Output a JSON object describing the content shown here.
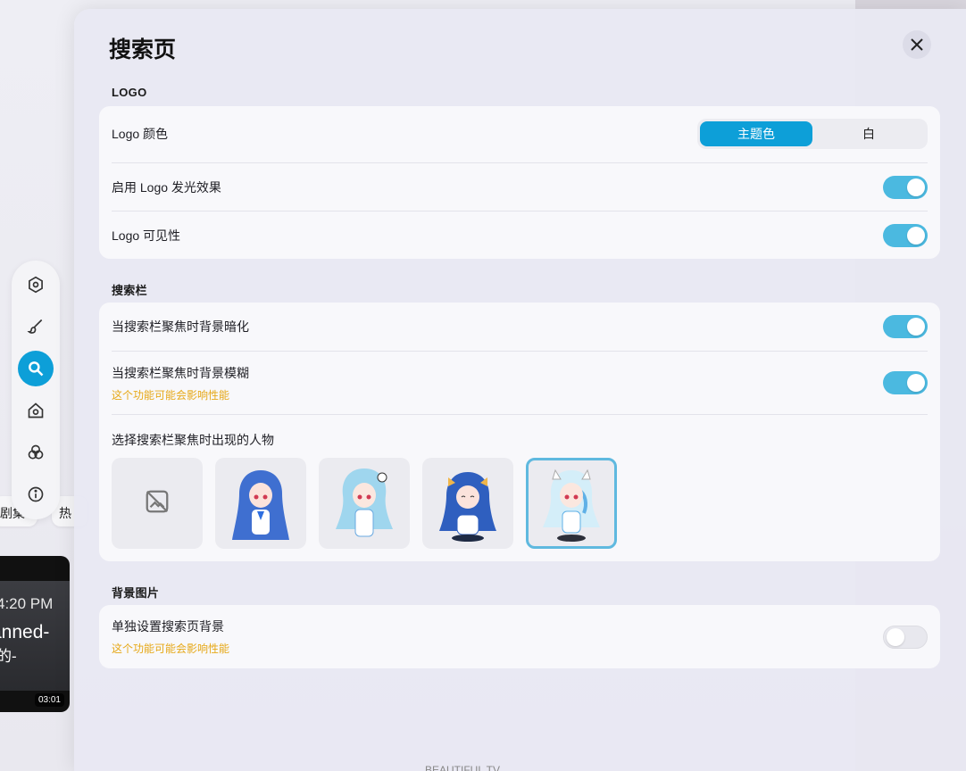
{
  "dialog": {
    "title": "搜索页",
    "close_icon": "close-icon"
  },
  "logo_section": {
    "label": "LOGO",
    "color_row": {
      "label": "Logo 颜色",
      "options": [
        "主题色",
        "白"
      ],
      "selected": "主题色"
    },
    "glow_row": {
      "label": "启用 Logo 发光效果",
      "enabled": true
    },
    "visible_row": {
      "label": "Logo 可见性",
      "enabled": true
    }
  },
  "searchbar_section": {
    "label": "搜索栏",
    "dim_row": {
      "label": "当搜索栏聚焦时背景暗化",
      "enabled": true
    },
    "blur_row": {
      "label": "当搜索栏聚焦时背景模糊",
      "sub": "这个功能可能会影响性能",
      "enabled": true
    },
    "character_row": {
      "label": "选择搜索栏聚焦时出现的人物",
      "options": [
        "none",
        "character-1",
        "character-2",
        "character-3",
        "character-4"
      ],
      "selected": "character-4"
    }
  },
  "background_section": {
    "label": "背景图片",
    "separate_row": {
      "label": "单独设置搜索页背景",
      "sub": "这个功能可能会影响性能",
      "enabled": false
    }
  },
  "side_nav": {
    "items": [
      "settings-icon",
      "brush-icon",
      "search-icon",
      "home-icon",
      "palette-icon",
      "info-icon"
    ],
    "active": "search-icon"
  },
  "background_app": {
    "chip_1": "剧集",
    "chip_2": "热",
    "video": {
      "time": "4:20 PM",
      "line1": "anned-",
      "line2": "的-",
      "line3": ".",
      "duration": "03:01"
    },
    "footer": "BEAUTIFUL TV"
  },
  "colors": {
    "accent": "#0d9fd8",
    "toggle_on": "#4bb9e0",
    "warning": "#e6a817"
  }
}
